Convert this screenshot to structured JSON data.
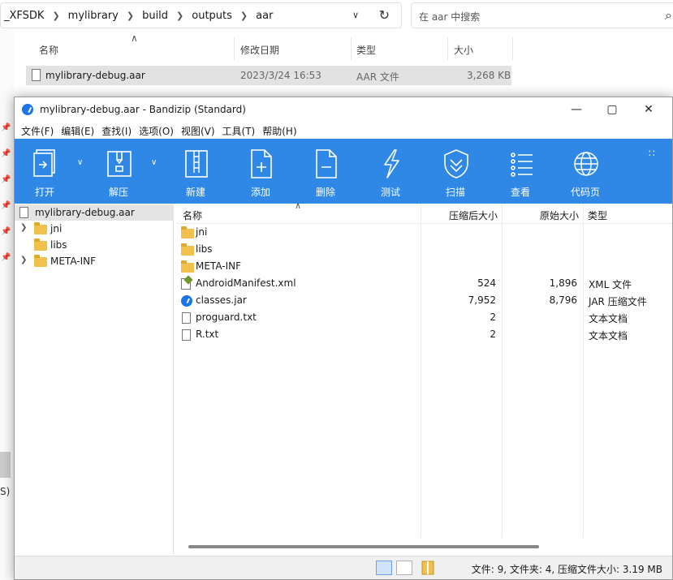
{
  "explorer": {
    "breadcrumbs": [
      "_XFSDK",
      "mylibrary",
      "build",
      "outputs",
      "aar"
    ],
    "search_placeholder": "在 aar 中搜索",
    "columns": {
      "name": "名称",
      "date": "修改日期",
      "type": "类型",
      "size": "大小"
    },
    "file": {
      "name": "mylibrary-debug.aar",
      "date": "2023/3/24 16:53",
      "type": "AAR 文件",
      "size": "3,268 KB"
    },
    "side_fragment": "S) ("
  },
  "bandizip": {
    "title": "mylibrary-debug.aar - Bandizip (Standard)",
    "menu": [
      "文件(F)",
      "编辑(E)",
      "查找(I)",
      "选项(O)",
      "视图(V)",
      "工具(T)",
      "帮助(H)"
    ],
    "toolbar": [
      {
        "label": "打开",
        "icon": "open-icon"
      },
      {
        "label": "解压",
        "icon": "extract-icon"
      },
      {
        "label": "新建",
        "icon": "new-archive-icon"
      },
      {
        "label": "添加",
        "icon": "add-file-icon"
      },
      {
        "label": "删除",
        "icon": "delete-file-icon"
      },
      {
        "label": "测试",
        "icon": "test-icon"
      },
      {
        "label": "扫描",
        "icon": "scan-shield-icon"
      },
      {
        "label": "查看",
        "icon": "view-list-icon"
      },
      {
        "label": "代码页",
        "icon": "codepage-globe-icon"
      }
    ],
    "tree": {
      "root": "mylibrary-debug.aar",
      "items": [
        {
          "label": "jni",
          "expandable": true
        },
        {
          "label": "libs",
          "expandable": false
        },
        {
          "label": "META-INF",
          "expandable": true
        }
      ]
    },
    "columns": {
      "name": "名称",
      "compressed": "压缩后大小",
      "original": "原始大小",
      "type": "类型"
    },
    "rows": [
      {
        "name": "jni",
        "icon": "folder-icon",
        "compressed": "",
        "original": "",
        "type": ""
      },
      {
        "name": "libs",
        "icon": "folder-icon",
        "compressed": "",
        "original": "",
        "type": ""
      },
      {
        "name": "META-INF",
        "icon": "folder-icon",
        "compressed": "",
        "original": "",
        "type": ""
      },
      {
        "name": "AndroidManifest.xml",
        "icon": "xml-file-icon",
        "compressed": "524",
        "original": "1,896",
        "type": "XML 文件"
      },
      {
        "name": "classes.jar",
        "icon": "jar-file-icon",
        "compressed": "7,952",
        "original": "8,796",
        "type": "JAR 压缩文件"
      },
      {
        "name": "proguard.txt",
        "icon": "text-file-icon",
        "compressed": "2",
        "original": "",
        "type": "文本文档"
      },
      {
        "name": "R.txt",
        "icon": "text-file-icon",
        "compressed": "2",
        "original": "",
        "type": "文本文档"
      }
    ],
    "status": "文件: 9, 文件夹: 4, 压缩文件大小: 3.19 MB"
  },
  "colors": {
    "toolbar": "#2f88e6",
    "folder": "#f2c04c",
    "selection": "#e4e4e4"
  }
}
